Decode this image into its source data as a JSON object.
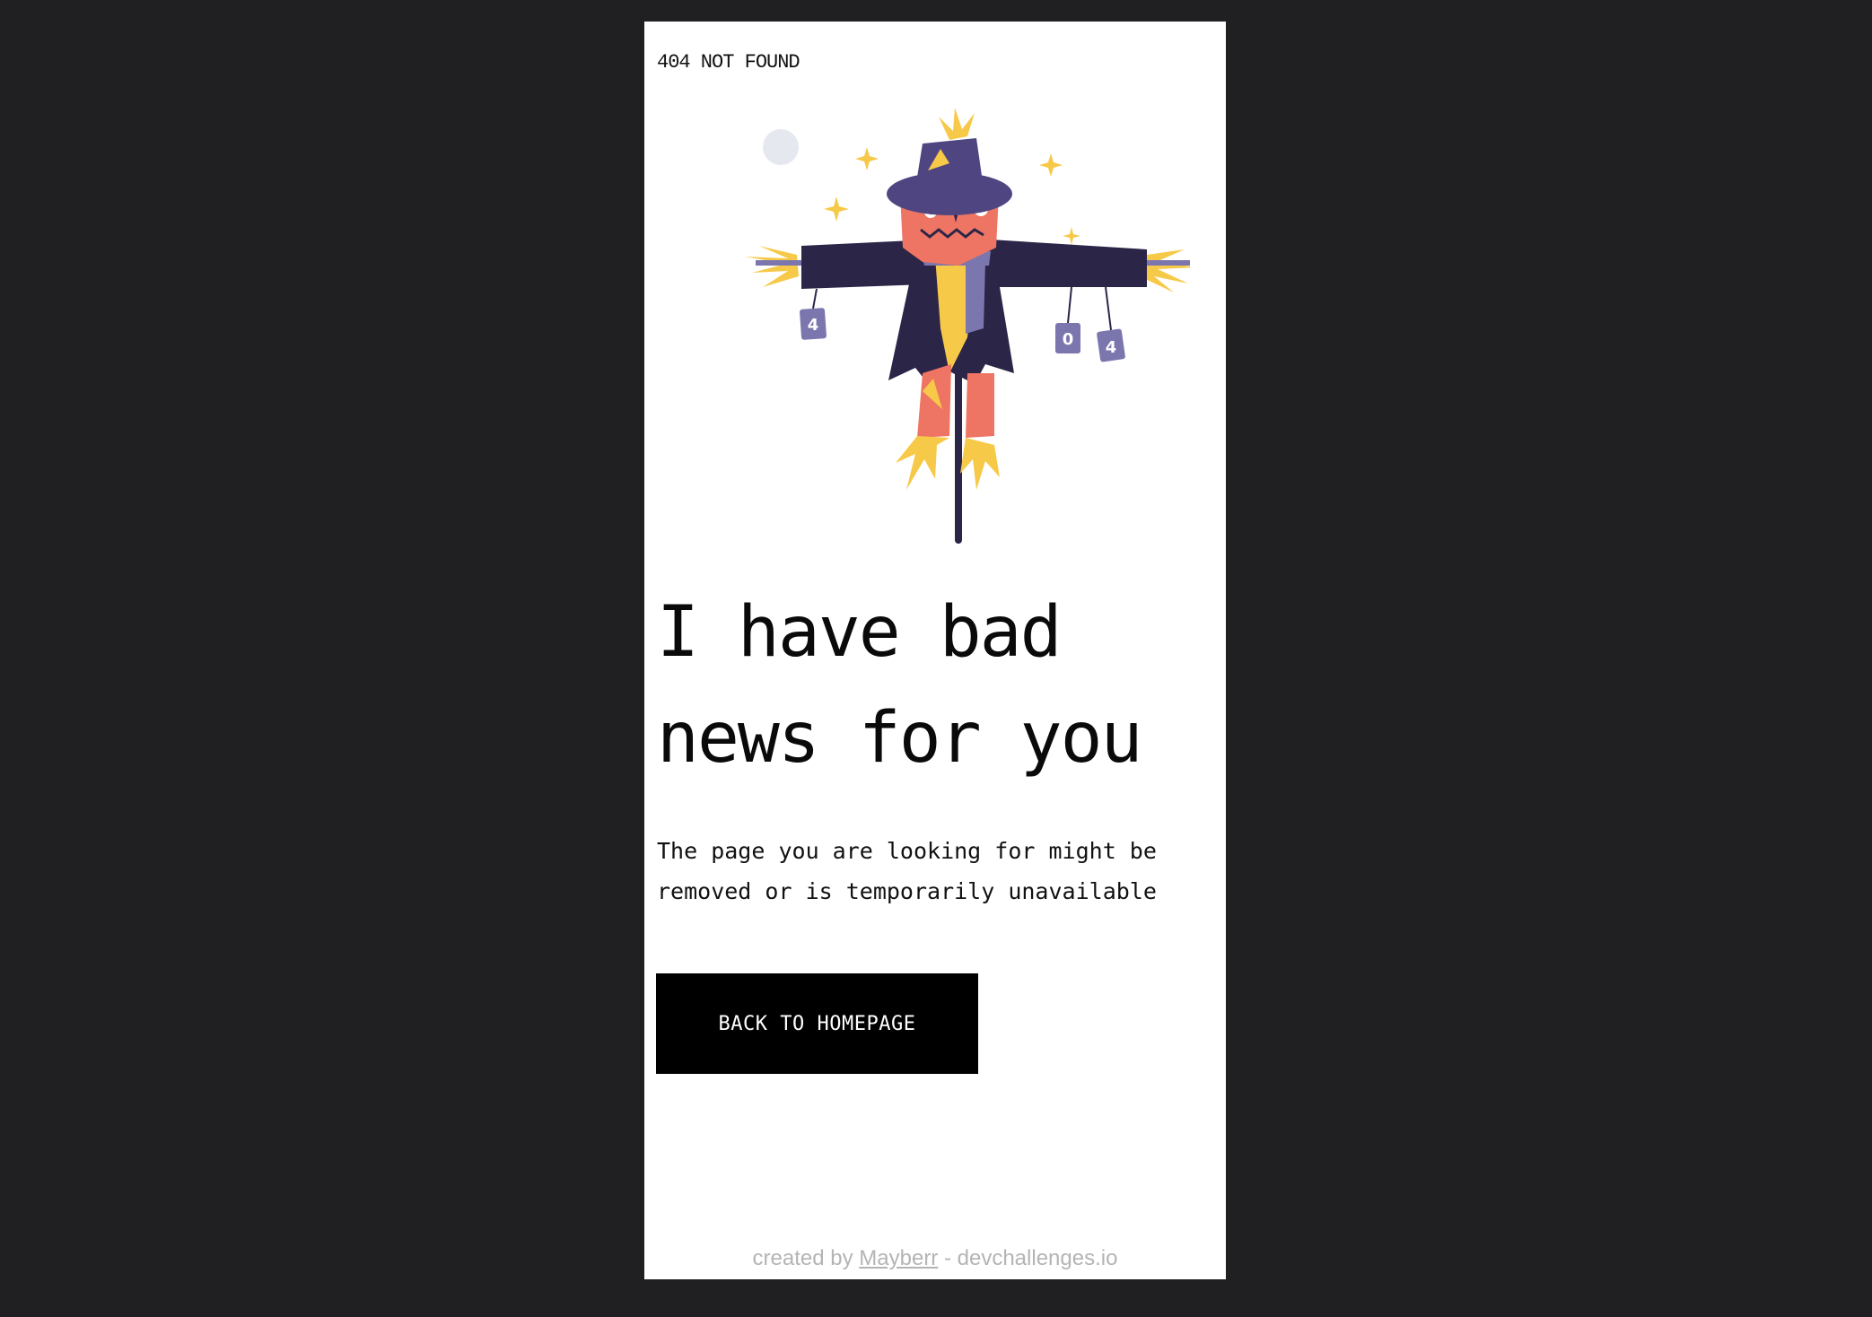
{
  "header": {
    "brand": "404 NOT FOUND"
  },
  "illustration": {
    "can_labels": [
      "4",
      "0",
      "4"
    ]
  },
  "main": {
    "headline_line1": "I have bad",
    "headline_line2": "news for you",
    "message_line1": "The page you are looking for might be",
    "message_line2": "removed or is temporarily unavailable",
    "button_label": "BACK TO HOMEPAGE"
  },
  "footer": {
    "prefix": "created by ",
    "author": "Mayberr",
    "suffix": " - devchallenges.io"
  },
  "colors": {
    "page_background": "#202022",
    "card_background": "#ffffff",
    "button_background": "#000000",
    "button_text": "#ffffff",
    "hat_and_coat": "#2b2548",
    "hat_purple": "#4f4681",
    "face_orange": "#ee7563",
    "straw_yellow": "#f7c948",
    "can_purple": "#7b76ad",
    "footer_text": "#b4b4b4"
  }
}
